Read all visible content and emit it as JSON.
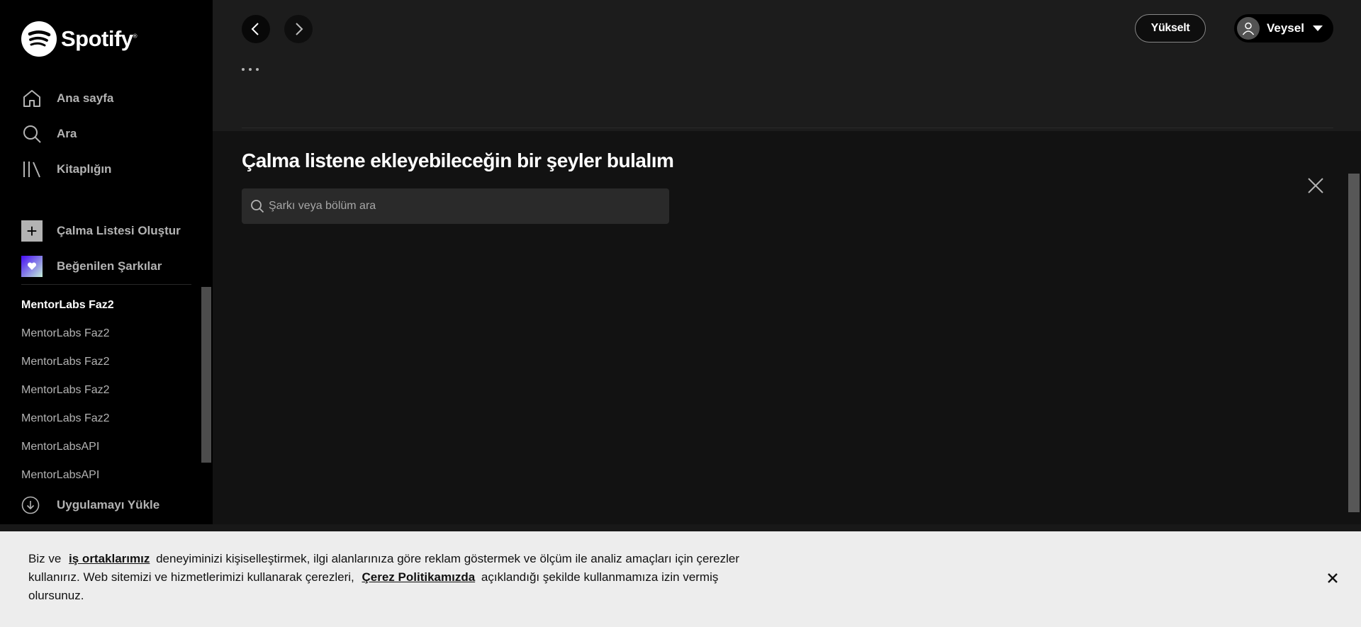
{
  "brand": {
    "name": "Spotify",
    "mark": "®",
    "accent": "#1db954"
  },
  "sidebar": {
    "nav": [
      {
        "label": "Ana sayfa",
        "icon": "home-icon"
      },
      {
        "label": "Ara",
        "icon": "search-icon"
      },
      {
        "label": "Kitaplığın",
        "icon": "library-icon"
      }
    ],
    "create_playlist": "Çalma Listesi Oluştur",
    "liked_songs": "Beğenilen Şarkılar",
    "playlists": [
      "MentorLabs Faz2",
      "MentorLabs Faz2",
      "MentorLabs Faz2",
      "MentorLabs Faz2",
      "MentorLabs Faz2",
      "MentorLabsAPI",
      "MentorLabsAPI"
    ],
    "install_app": "Uygulamayı Yükle"
  },
  "header": {
    "upgrade_label": "Yükselt",
    "user_name": "Veysel"
  },
  "main": {
    "find_title": "Çalma listene ekleyebileceğin bir şeyler bulalım",
    "search_placeholder": "Şarkı veya bölüm ara"
  },
  "cookie": {
    "part1": "Biz ve",
    "link1": "iş ortaklarımız",
    "part2": "deneyiminizi kişiselleştirmek, ilgi alanlarınıza göre reklam göstermek ve ölçüm ile analiz amaçları için çerezler kullanırız. Web sitemizi ve hizmetlerimizi kullanarak çerezleri,",
    "link2": "Çerez Politikamızda",
    "part3": "açıklandığı şekilde kullanmamıza izin vermiş olursunuz."
  }
}
